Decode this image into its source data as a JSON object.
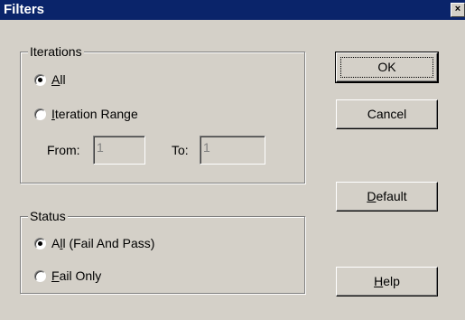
{
  "window": {
    "title": "Filters",
    "close_glyph": "×"
  },
  "iterations": {
    "legend": "Iterations",
    "all": {
      "label": "All",
      "accel": "A",
      "rest": "ll",
      "checked": true
    },
    "range": {
      "label": "Iteration Range",
      "accel": "I",
      "rest": "teration Range",
      "checked": false
    },
    "from_label": "From:",
    "from_value": "1",
    "to_label": "To:",
    "to_value": "1"
  },
  "status": {
    "legend": "Status",
    "all": {
      "label": "All (Fail And Pass)",
      "pre": "A",
      "accel": "l",
      "rest": "l (Fail And Pass)",
      "checked": true
    },
    "fail": {
      "label": "Fail Only",
      "accel": "F",
      "rest": "ail Only",
      "checked": false
    }
  },
  "buttons": {
    "ok": "OK",
    "cancel": "Cancel",
    "default": {
      "label": "Default",
      "accel": "D",
      "rest": "efault"
    },
    "help": {
      "label": "Help",
      "accel": "H",
      "rest": "elp"
    }
  }
}
